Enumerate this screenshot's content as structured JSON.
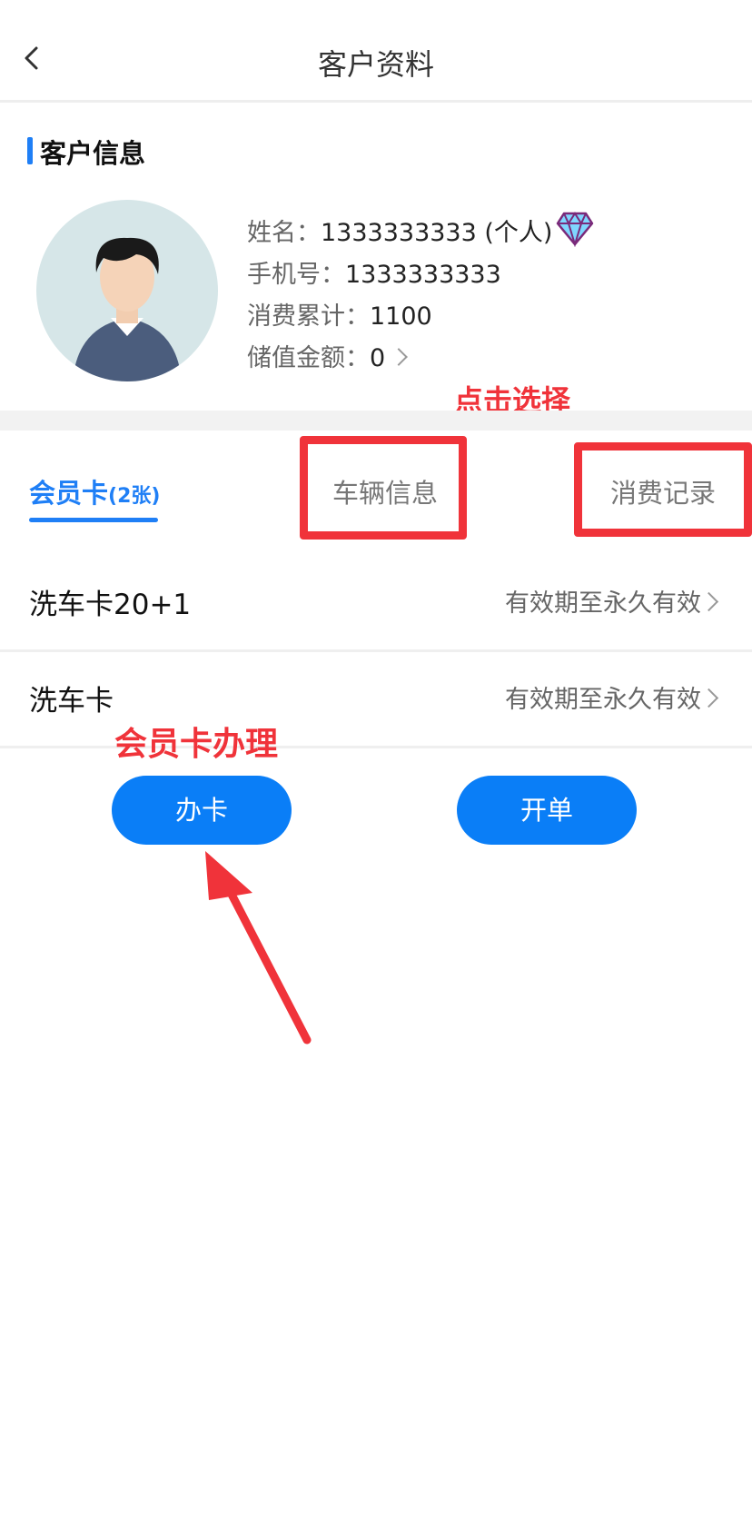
{
  "nav": {
    "title": "客户资料"
  },
  "section": {
    "title": "客户信息"
  },
  "customer": {
    "name_label": "姓名：",
    "name_value": "1333333333 (个人)",
    "phone_label": "手机号：",
    "phone_value": "1333333333",
    "spend_label": "消费累计：",
    "spend_value": "1100",
    "balance_label": "储值金额：",
    "balance_value": "0"
  },
  "annotations": {
    "select_hint": "点击选择",
    "card_hint": "会员卡办理"
  },
  "tabs": {
    "member_label": "会员卡",
    "member_count": "(2张)",
    "vehicle_label": "车辆信息",
    "record_label": "消费记录"
  },
  "cards": [
    {
      "name": "洗车卡20+1",
      "expiry": "有效期至永久有效"
    },
    {
      "name": "洗车卡",
      "expiry": "有效期至永久有效"
    }
  ],
  "buttons": {
    "open_card": "办卡",
    "new_order": "开单"
  },
  "colors": {
    "accent": "#1f7ff6",
    "annotation": "#f0333a",
    "button": "#0a7ef7"
  },
  "icons": [
    "back-icon",
    "diamond-icon",
    "chevron-right-icon",
    "avatar-image",
    "arrow-annotation"
  ]
}
